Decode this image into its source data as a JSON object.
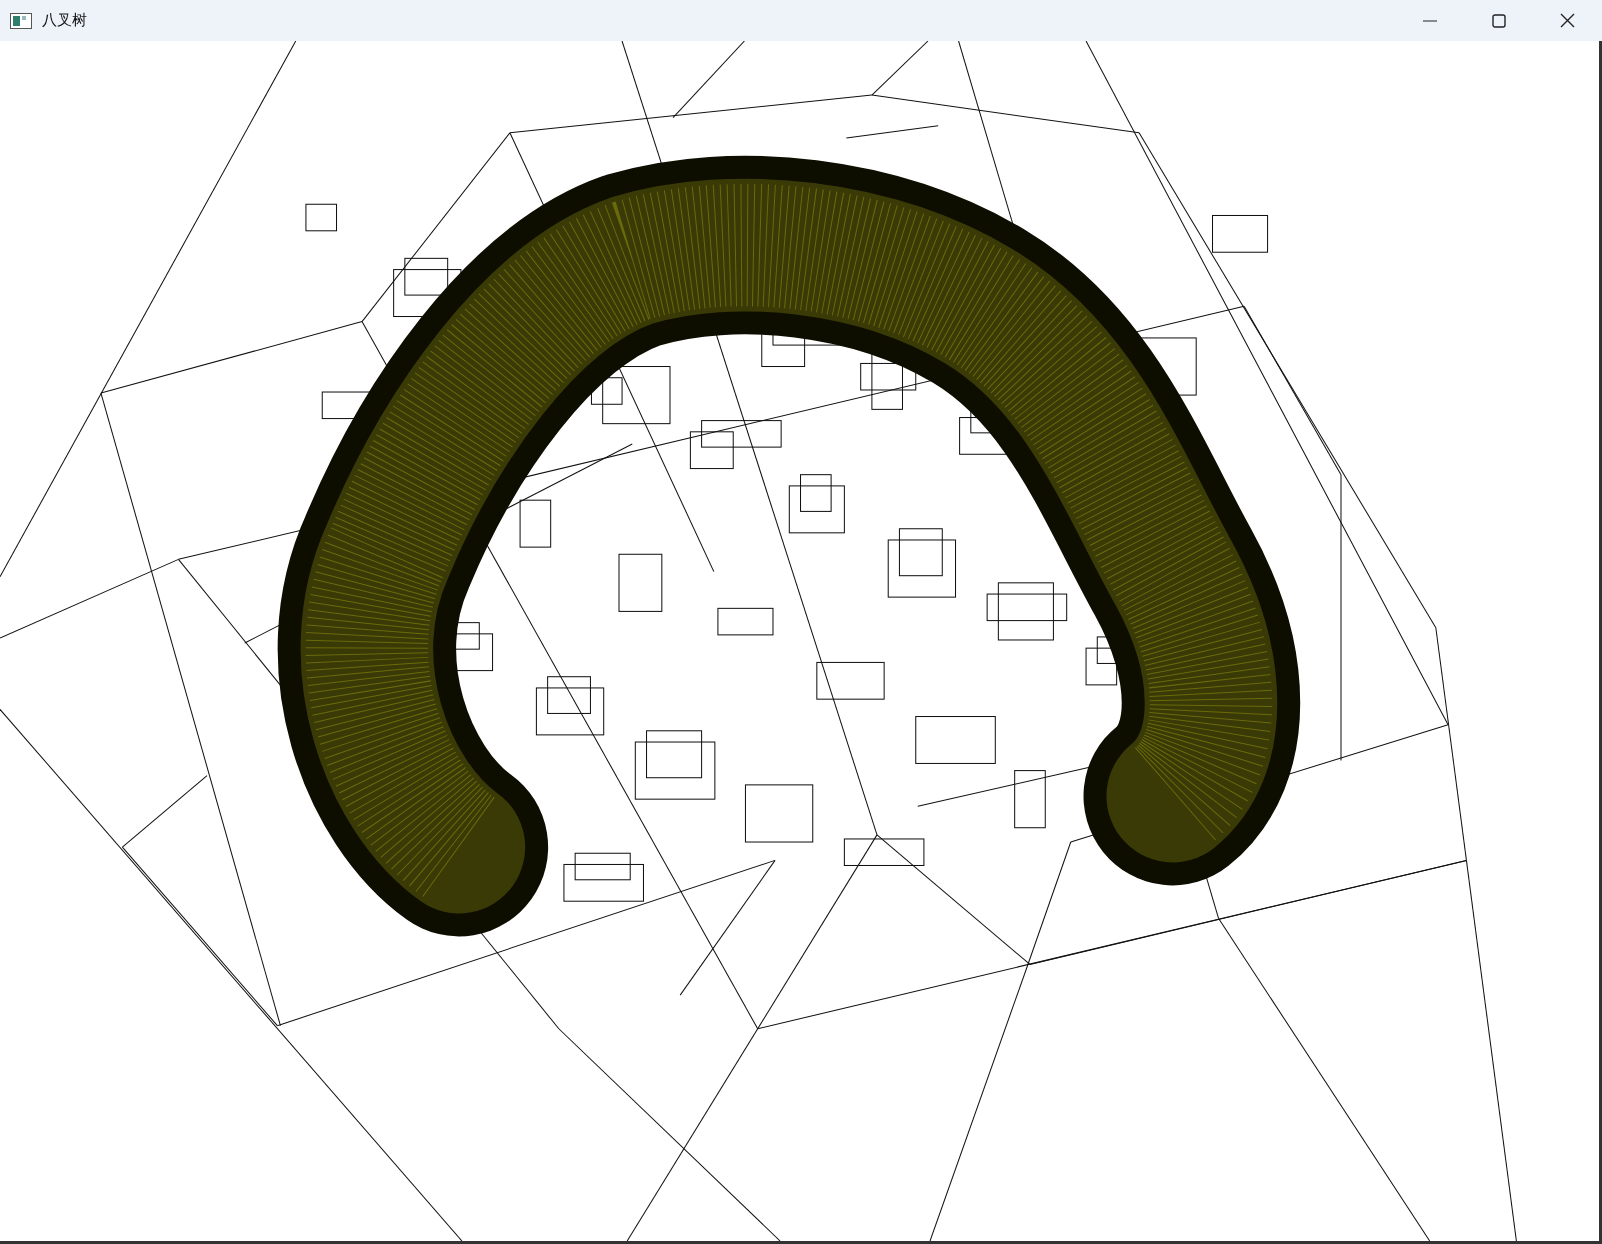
{
  "window": {
    "title": "八叉树"
  }
}
